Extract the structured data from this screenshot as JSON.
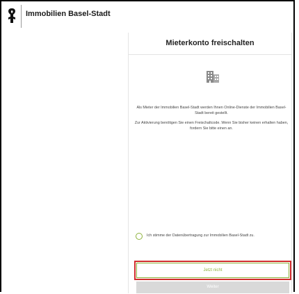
{
  "header": {
    "brand_name": "Immobilien Basel-Stadt",
    "logo_icon": "basel-crozier-icon"
  },
  "page": {
    "title": "Mieterkonto freischalten",
    "hero_icon": "building-icon",
    "intro_line_1": "Als Mieter der Immobilien Basel-Stadt werden Ihnen Online-Dienste der Immobilien Basel-Stadt bereit gestellt.",
    "intro_line_2": "Zur Aktivierung benötigen Sie einen Freischaltcode. Wenn Sie bisher keinen erhalten haben, fordern Sie bitte einen an."
  },
  "consent": {
    "label": "Ich stimme der Datenübertragung zur Immobilien Basel-Stadt zu.",
    "checked": false
  },
  "actions": {
    "later_label": "Jetzt nicht",
    "next_label": "Weiter"
  },
  "colors": {
    "accent": "#8db23b",
    "highlight": "#d12d2d",
    "disabled": "#d9d9d9"
  }
}
